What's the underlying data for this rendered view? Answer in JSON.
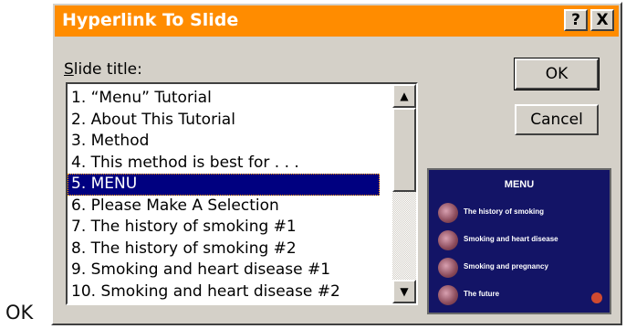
{
  "outside_label": "OK",
  "dialog": {
    "title": "Hyperlink To Slide",
    "help_glyph": "?",
    "close_glyph": "X",
    "field_label_mnemonic": "S",
    "field_label_rest": "lide title:",
    "ok_label": "OK",
    "cancel_label": "Cancel"
  },
  "slides": [
    "1. “Menu” Tutorial",
    "2. About This Tutorial",
    "3. Method",
    "4. This method is best for . . .",
    "5. MENU",
    "6. Please Make A Selection",
    "7. The history of smoking #1",
    "8. The history of smoking #2",
    "9. Smoking and heart disease #1",
    "10. Smoking and heart disease #2"
  ],
  "selected_index": 4,
  "preview": {
    "title": "MENU",
    "items": [
      "The history of smoking",
      "Smoking and heart disease",
      "Smoking and pregnancy",
      "The future"
    ],
    "bg_color": "#131466"
  },
  "icons": {
    "scroll_up": "▲",
    "scroll_down": "▼"
  },
  "colors": {
    "titlebar": "#ff8c00",
    "selection": "#000080",
    "face": "#d4d0c8"
  }
}
